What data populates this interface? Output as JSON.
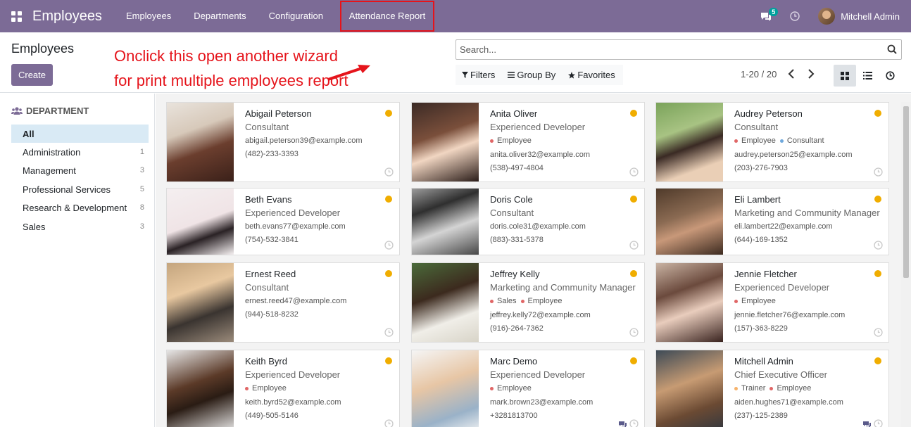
{
  "navbar": {
    "app_name": "Employees",
    "menu": [
      "Employees",
      "Departments",
      "Configuration",
      "Attendance Report"
    ],
    "messages_count": "5",
    "user_name": "Mitchell Admin"
  },
  "control_panel": {
    "title": "Employees",
    "create_label": "Create",
    "annotation_line1": "Onclick this open another wizard",
    "annotation_line2": "for print multiple employees report",
    "search_placeholder": "Search...",
    "filters_label": "Filters",
    "groupby_label": "Group By",
    "favorites_label": "Favorites",
    "pager": "1-20 / 20"
  },
  "sidebar": {
    "heading": "DEPARTMENT",
    "items": [
      {
        "label": "All",
        "count": ""
      },
      {
        "label": "Administration",
        "count": "1"
      },
      {
        "label": "Management",
        "count": "3"
      },
      {
        "label": "Professional Services",
        "count": "5"
      },
      {
        "label": "Research & Development",
        "count": "8"
      },
      {
        "label": "Sales",
        "count": "3"
      }
    ]
  },
  "employees": [
    {
      "name": "Abigail Peterson",
      "job": "Consultant",
      "tags": [],
      "email": "abigail.peterson39@example.com",
      "phone": "(482)-233-3393",
      "chat": false
    },
    {
      "name": "Anita Oliver",
      "job": "Experienced Developer",
      "tags": [
        {
          "label": "Employee",
          "color": "#e06666"
        }
      ],
      "email": "anita.oliver32@example.com",
      "phone": "(538)-497-4804",
      "chat": false
    },
    {
      "name": "Audrey Peterson",
      "job": "Consultant",
      "tags": [
        {
          "label": "Employee",
          "color": "#e06666"
        },
        {
          "label": "Consultant",
          "color": "#6fa8dc"
        }
      ],
      "email": "audrey.peterson25@example.com",
      "phone": "(203)-276-7903",
      "chat": false
    },
    {
      "name": "Beth Evans",
      "job": "Experienced Developer",
      "tags": [],
      "email": "beth.evans77@example.com",
      "phone": "(754)-532-3841",
      "chat": false
    },
    {
      "name": "Doris Cole",
      "job": "Consultant",
      "tags": [],
      "email": "doris.cole31@example.com",
      "phone": "(883)-331-5378",
      "chat": false
    },
    {
      "name": "Eli Lambert",
      "job": "Marketing and Community Manager",
      "tags": [],
      "email": "eli.lambert22@example.com",
      "phone": "(644)-169-1352",
      "chat": false
    },
    {
      "name": "Ernest Reed",
      "job": "Consultant",
      "tags": [],
      "email": "ernest.reed47@example.com",
      "phone": "(944)-518-8232",
      "chat": false
    },
    {
      "name": "Jeffrey Kelly",
      "job": "Marketing and Community Manager",
      "tags": [
        {
          "label": "Sales",
          "color": "#e06666"
        },
        {
          "label": "Employee",
          "color": "#e06666"
        }
      ],
      "email": "jeffrey.kelly72@example.com",
      "phone": "(916)-264-7362",
      "chat": false
    },
    {
      "name": "Jennie Fletcher",
      "job": "Experienced Developer",
      "tags": [
        {
          "label": "Employee",
          "color": "#e06666"
        }
      ],
      "email": "jennie.fletcher76@example.com",
      "phone": "(157)-363-8229",
      "chat": false
    },
    {
      "name": "Keith Byrd",
      "job": "Experienced Developer",
      "tags": [
        {
          "label": "Employee",
          "color": "#e06666"
        }
      ],
      "email": "keith.byrd52@example.com",
      "phone": "(449)-505-5146",
      "chat": false
    },
    {
      "name": "Marc Demo",
      "job": "Experienced Developer",
      "tags": [
        {
          "label": "Employee",
          "color": "#e06666"
        }
      ],
      "email": "mark.brown23@example.com",
      "phone": "+3281813700",
      "chat": true
    },
    {
      "name": "Mitchell Admin",
      "job": "Chief Executive Officer",
      "tags": [
        {
          "label": "Trainer",
          "color": "#f6b26b"
        },
        {
          "label": "Employee",
          "color": "#e06666"
        }
      ],
      "email": "aiden.hughes71@example.com",
      "phone": "(237)-125-2389",
      "chat": true
    }
  ],
  "colors": {
    "brand": "#7c6b96",
    "annotation": "#e5141b",
    "status": "#f0ad00"
  }
}
